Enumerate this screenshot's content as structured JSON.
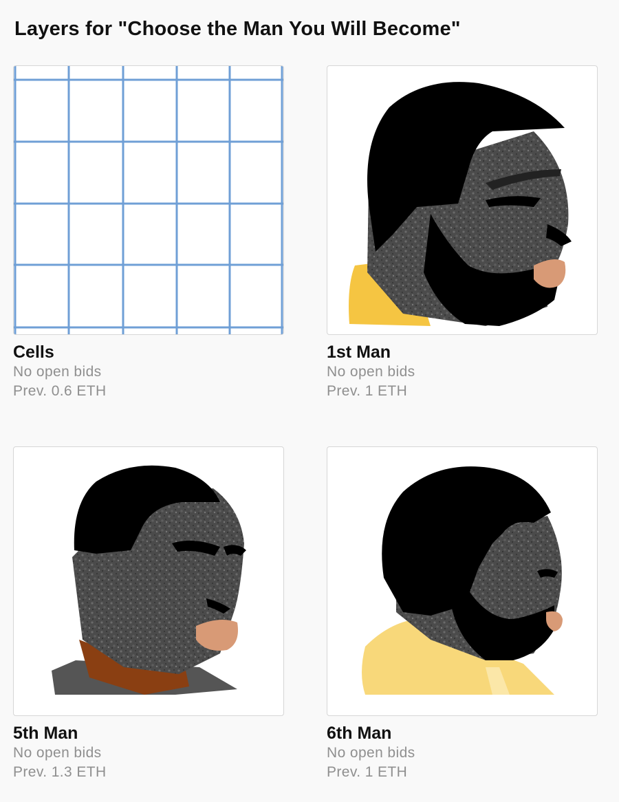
{
  "page": {
    "title": "Layers for \"Choose the Man You Will Become\""
  },
  "layers": [
    {
      "name": "Cells",
      "bids": "No open bids",
      "prev": "Prev. 0.6 ETH",
      "image": "grid-cells-art"
    },
    {
      "name": "1st Man",
      "bids": "No open bids",
      "prev": "Prev. 1 ETH",
      "image": "bearded-man-portrait"
    },
    {
      "name": "5th Man",
      "bids": "No open bids",
      "prev": "Prev. 1.3 ETH",
      "image": "man-portrait-brown-scarf"
    },
    {
      "name": "6th Man",
      "bids": "No open bids",
      "prev": "Prev. 1 ETH",
      "image": "man-portrait-yellow-hoodie"
    }
  ],
  "colors": {
    "grid_line": "#6f9fd6",
    "hair": "#000000",
    "skin_texture": "#4a4a4a",
    "lips": "#d89a76",
    "yellow_collar": "#f5c542",
    "brown_scarf": "#8a3f12",
    "pale_yellow_hoodie": "#f8d87a"
  }
}
